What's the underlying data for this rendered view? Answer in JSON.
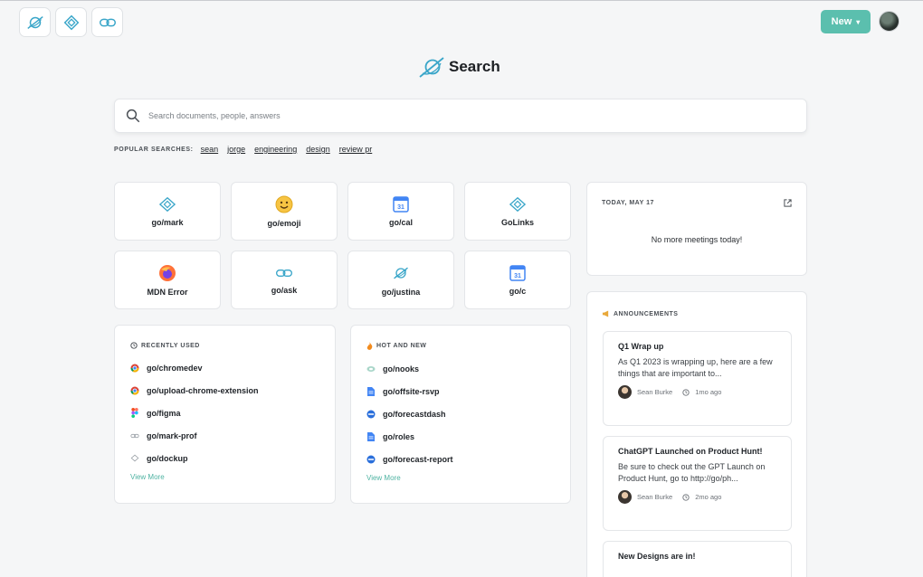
{
  "header": {
    "app_buttons": [
      {
        "icon": "galaxy-logo-icon"
      },
      {
        "icon": "golinks-diamond-icon"
      },
      {
        "icon": "link-chain-icon"
      }
    ],
    "new_label": "New",
    "new_caret": "▾"
  },
  "brand": {
    "title": "Search"
  },
  "search": {
    "placeholder": "Search documents, people, answers"
  },
  "popular": {
    "label": "POPULAR SEARCHES:",
    "items": [
      "sean",
      "jorge",
      "engineering",
      "design",
      "review pr"
    ]
  },
  "tiles": [
    {
      "label": "go/mark",
      "icon": "golinks-diamond-icon"
    },
    {
      "label": "go/emoji",
      "icon": "emoji-icon"
    },
    {
      "label": "go/cal",
      "icon": "calendar-icon"
    },
    {
      "label": "GoLinks",
      "icon": "golinks-diamond-icon"
    },
    {
      "label": "MDN Error",
      "icon": "firefox-icon"
    },
    {
      "label": "go/ask",
      "icon": "link-chain-icon"
    },
    {
      "label": "go/justina",
      "icon": "galaxy-logo-icon"
    },
    {
      "label": "go/c",
      "icon": "calendar-icon"
    }
  ],
  "recently_used": {
    "title": "RECENTLY USED",
    "items": [
      {
        "label": "go/chromedev",
        "icon": "chrome-icon"
      },
      {
        "label": "go/upload-chrome-extension",
        "icon": "chrome-icon"
      },
      {
        "label": "go/figma",
        "icon": "figma-icon"
      },
      {
        "label": "go/mark-prof",
        "icon": "link-chain-icon"
      },
      {
        "label": "go/dockup",
        "icon": "golinks-diamond-icon"
      }
    ],
    "view_more": "View More"
  },
  "hot_and_new": {
    "title": "HOT AND NEW",
    "items": [
      {
        "label": "go/nooks",
        "icon": "nooks-icon"
      },
      {
        "label": "go/offsite-rsvp",
        "icon": "doc-icon"
      },
      {
        "label": "go/forecastdash",
        "icon": "dash-icon"
      },
      {
        "label": "go/roles",
        "icon": "doc-icon"
      },
      {
        "label": "go/forecast-report",
        "icon": "dash-icon"
      }
    ],
    "view_more": "View More"
  },
  "today": {
    "title": "TODAY, MAY 17",
    "empty_text": "No more meetings today!"
  },
  "announcements": {
    "title": "ANNOUNCEMENTS",
    "cards": [
      {
        "title": "Q1 Wrap up",
        "body": "As Q1 2023 is wrapping up, here are a few things that are important to...",
        "author": "Sean Burke",
        "time": "1mo ago"
      },
      {
        "title": "ChatGPT Launched on Product Hunt!",
        "body": "Be sure to check out the GPT Launch on Product Hunt, go to http://go/ph...",
        "author": "Sean Burke",
        "time": "2mo ago"
      },
      {
        "title": "New Designs are in!",
        "body": "",
        "author": "",
        "time": ""
      }
    ]
  },
  "colors": {
    "accent": "#5bbfae",
    "link_teal": "#4fb3a2",
    "icon_blue": "#3aa6c9"
  }
}
